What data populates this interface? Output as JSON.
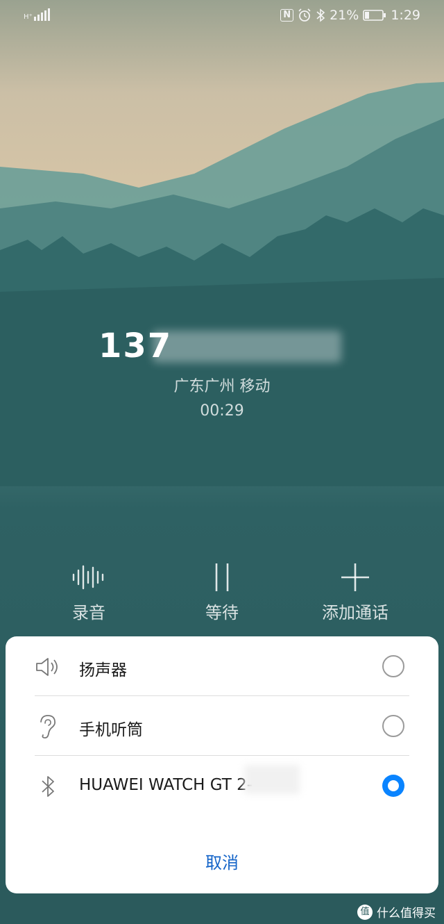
{
  "status_bar": {
    "signal_label": "H⁺",
    "nfc_icon": "N",
    "battery_percent": "21%",
    "time": "1:29"
  },
  "call": {
    "number_visible": "137",
    "location": "广东广州 移动",
    "duration": "00:29"
  },
  "controls": [
    {
      "label": "录音",
      "icon": "waveform-icon"
    },
    {
      "label": "等待",
      "icon": "pause-icon"
    },
    {
      "label": "添加通话",
      "icon": "plus-icon"
    }
  ],
  "audio_sheet": {
    "options": [
      {
        "label": "扬声器",
        "icon": "speaker-icon",
        "selected": false
      },
      {
        "label": "手机听筒",
        "icon": "ear-icon",
        "selected": false
      },
      {
        "label": "HUAWEI WATCH GT 2-",
        "icon": "bluetooth-icon",
        "selected": true
      }
    ],
    "cancel_label": "取消"
  },
  "watermark": "什么值得买",
  "colors": {
    "accent": "#0a84ff",
    "cancel_text": "#1464c8",
    "background_teal": "#2b5a5c"
  }
}
